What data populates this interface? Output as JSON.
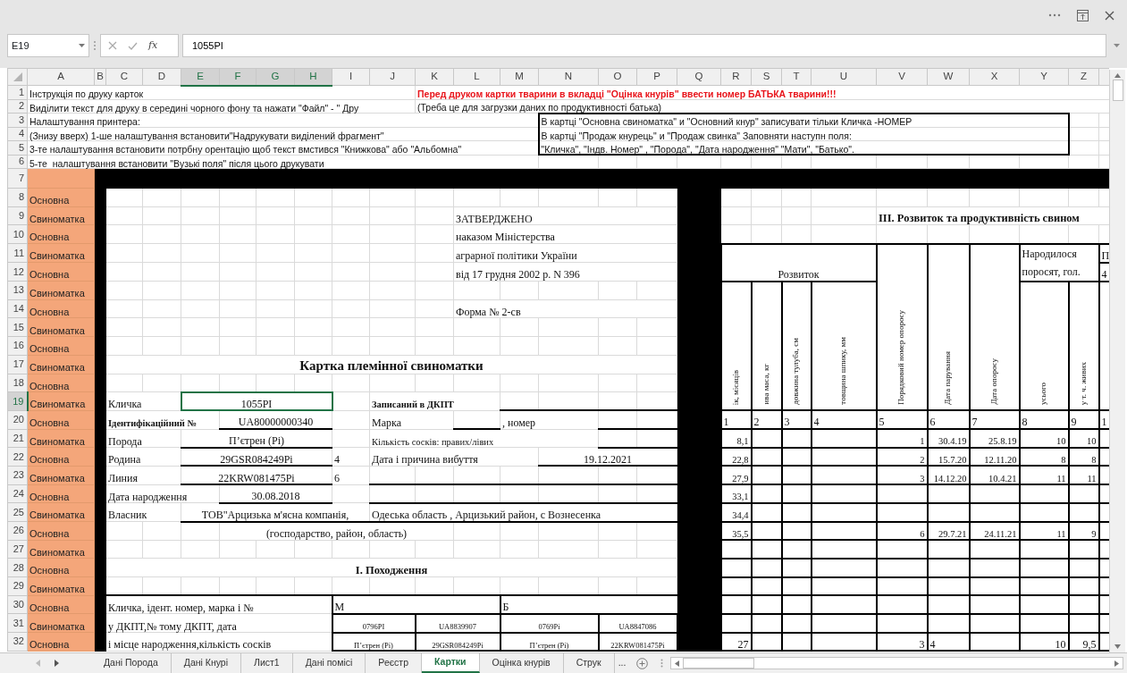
{
  "formula_bar": {
    "name_box": "E19",
    "function_label": "fx",
    "formula": "1055PI"
  },
  "sheet": {
    "columns": [
      {
        "label": "A",
        "selected": false,
        "kind": "category"
      },
      {
        "label": "B",
        "selected": false,
        "kind": "frame"
      },
      {
        "label": "C",
        "selected": false,
        "kind": "plain"
      },
      {
        "label": "D",
        "selected": false,
        "kind": "plain"
      },
      {
        "label": "E",
        "selected": true,
        "kind": "plain"
      },
      {
        "label": "F",
        "selected": true,
        "kind": "plain"
      },
      {
        "label": "G",
        "selected": true,
        "kind": "plain"
      },
      {
        "label": "H",
        "selected": true,
        "kind": "plain"
      },
      {
        "label": "I",
        "selected": false,
        "kind": "plain"
      },
      {
        "label": "J",
        "selected": false,
        "kind": "plain"
      },
      {
        "label": "K",
        "selected": false,
        "kind": "plain"
      },
      {
        "label": "L",
        "selected": false,
        "kind": "plain"
      },
      {
        "label": "M",
        "selected": false,
        "kind": "plain"
      },
      {
        "label": "N",
        "selected": false,
        "kind": "plain"
      },
      {
        "label": "O",
        "selected": false,
        "kind": "plain"
      },
      {
        "label": "P",
        "selected": false,
        "kind": "plain"
      },
      {
        "label": "Q",
        "selected": false,
        "kind": "frame"
      },
      {
        "label": "R",
        "selected": false,
        "kind": "plain"
      },
      {
        "label": "S",
        "selected": false,
        "kind": "plain"
      },
      {
        "label": "T",
        "selected": false,
        "kind": "plain"
      },
      {
        "label": "U",
        "selected": false,
        "kind": "plain"
      },
      {
        "label": "V",
        "selected": false,
        "kind": "plain"
      },
      {
        "label": "W",
        "selected": false,
        "kind": "plain"
      },
      {
        "label": "X",
        "selected": false,
        "kind": "plain"
      },
      {
        "label": "Y",
        "selected": false,
        "kind": "plain"
      },
      {
        "label": "Z",
        "selected": false,
        "kind": "plain"
      },
      {
        "selected": false,
        "kind": "plain"
      }
    ],
    "rows": [
      {
        "label": "1",
        "kind": "note",
        "selected": false,
        "cells": [
          {
            "text": "Інструкція по друку карток",
            "colspan": 10
          },
          {
            "text": "Перед друком картки тварини в вкладці \"Оцінка кнурів\" ввести номер БАТЬКА тварини!!!",
            "kind": "warning",
            "colspan": 17
          }
        ]
      },
      {
        "label": "2",
        "kind": "note",
        "selected": false,
        "cells": [
          {
            "text": "Виділити текст для друку в середині чорного фону та нажати \"Файл\" - \" Дру",
            "colspan": 10
          },
          {
            "text": "(Треба це для загрузки даних по продуктивності батька)",
            "colspan": 17
          }
        ]
      },
      {
        "label": "3",
        "kind": "note",
        "selected": false,
        "cells": [
          {
            "text": "Налаштування принтера:",
            "colspan": 13
          },
          {
            "text": "В картці \"Основна свиноматка\" и \"Основний кнур\" записувати тільки Кличка -НОМЕР",
            "colspan": 12
          },
          {
            "text": "",
            "colspan": 2
          }
        ]
      },
      {
        "label": "4",
        "kind": "note",
        "selected": false,
        "cells": [
          {
            "text": "(Знизу вверх) 1-ше налаштування встановити\"Надрукувати виділений фрагмент\"",
            "colspan": 13
          },
          {
            "text": "В картці \"Продаж кнурець\" и \"Продаж свинка\" Заповняти наступн поля:",
            "colspan": 12
          },
          {
            "text": "",
            "colspan": 2
          }
        ]
      },
      {
        "label": "5",
        "kind": "note",
        "selected": false,
        "cells": [
          {
            "text": "3-те налаштування встановити потрбну орентацію щоб текст вмстився \"Книжкова\" або \"Альбомна\"",
            "colspan": 13
          },
          {
            "text": "\"Кличка\", \"Індв. Номер\" , \"Порода\", \"Дата народження\" \"Мати\", \"Батько\".",
            "colspan": 12
          },
          {
            "text": "",
            "colspan": 2
          }
        ]
      },
      {
        "label": "6",
        "kind": "note",
        "selected": false,
        "cells": [
          {
            "text": "5-те  налаштування встановити \"Вузькі поля\" після цього друкувати",
            "colspan": 13
          },
          {
            "text": "",
            "colspan": 14
          }
        ]
      },
      {
        "label": "7",
        "kind": "gap",
        "selected": false,
        "cells": [
          {
            "text": ""
          },
          {
            "text": "",
            "colspan": 26
          }
        ]
      },
      {
        "label": "8",
        "kind": "form",
        "selected": false,
        "cells": [
          {
            "text": "Основна",
            "kind": "category"
          },
          {
            "text": ""
          },
          {
            "text": "",
            "colspan": 14
          },
          {
            "text": ""
          },
          {
            "text": "",
            "colspan": 10
          }
        ]
      },
      {
        "label": "9",
        "kind": "form",
        "selected": false,
        "cells": [
          {
            "text": "Свиноматка",
            "kind": "category"
          },
          {
            "text": ""
          },
          {
            "text": "",
            "colspan": 9
          },
          {
            "text": "ЗАТВЕРДЖЕНО",
            "colspan": 5
          },
          {
            "text": ""
          },
          {
            "text": "",
            "colspan": 4
          },
          {
            "text": "ІІІ. Розвиток та продуктивність свином",
            "kind": "heading",
            "colspan": 6
          }
        ]
      },
      {
        "label": "10",
        "kind": "form",
        "selected": false,
        "cells": [
          {
            "text": "Основна",
            "kind": "category"
          },
          {
            "text": ""
          },
          {
            "text": "",
            "colspan": 9
          },
          {
            "text": "наказом Міністерства",
            "colspan": 5
          },
          {
            "text": ""
          },
          {
            "text": "",
            "colspan": 10
          }
        ]
      },
      {
        "label": "11",
        "kind": "form",
        "selected": false,
        "cells": [
          {
            "text": "Свиноматка",
            "kind": "category"
          },
          {
            "text": ""
          },
          {
            "text": "",
            "colspan": 9
          },
          {
            "text": "аграрної політики України",
            "colspan": 5
          },
          {
            "text": ""
          },
          {
            "text": "Розвиток",
            "colspan": 4,
            "rowspan": 2
          },
          {
            "text": "",
            "rowspan": 2
          },
          {
            "text": "",
            "rowspan": 2
          },
          {
            "text": "",
            "rowspan": 2
          },
          {
            "text": "Народилося поросят, гол.",
            "kind": "wrapped",
            "colspan": 2,
            "rowspan": 2
          },
          {
            "text": "П"
          }
        ]
      },
      {
        "label": "12",
        "kind": "form",
        "selected": false,
        "cells": [
          {
            "text": "Основна",
            "kind": "category"
          },
          {
            "text": ""
          },
          {
            "text": "",
            "colspan": 9
          },
          {
            "text": "від 17 грудня 2002 р. N 396",
            "colspan": 5
          },
          {
            "text": ""
          },
          {
            "text": "4"
          }
        ]
      },
      {
        "label": "13",
        "kind": "form",
        "selected": false,
        "cells": [
          {
            "text": "Свиноматка",
            "kind": "category"
          },
          {
            "text": ""
          },
          {
            "text": "",
            "colspan": 14
          },
          {
            "text": ""
          },
          {
            "text": "ік, місяців",
            "kind": "vertical",
            "rowspan": 7
          },
          {
            "text": "ива маса, кг",
            "kind": "vertical",
            "rowspan": 7
          },
          {
            "text": "довжина тулуба, см",
            "kind": "vertical",
            "rowspan": 7
          },
          {
            "text": "товщина шпику, мм",
            "kind": "vertical",
            "rowspan": 7
          },
          {
            "text": "Порядковий номер опоросу",
            "kind": "vertical",
            "rowspan": 7
          },
          {
            "text": "Дата парування",
            "kind": "vertical",
            "rowspan": 7
          },
          {
            "text": "Дата опоросу",
            "kind": "vertical",
            "rowspan": 7
          },
          {
            "text": "усього",
            "kind": "vertical",
            "rowspan": 7
          },
          {
            "text": "у т. ч. живих",
            "kind": "vertical",
            "rowspan": 7
          },
          {
            "text": "",
            "rowspan": 7
          }
        ]
      },
      {
        "label": "14",
        "kind": "form",
        "selected": false,
        "cells": [
          {
            "text": "Основна",
            "kind": "category"
          },
          {
            "text": ""
          },
          {
            "text": "",
            "colspan": 9
          },
          {
            "text": "Форма № 2-св",
            "colspan": 5
          },
          {
            "text": ""
          }
        ]
      },
      {
        "label": "15",
        "kind": "form",
        "selected": false,
        "cells": [
          {
            "text": "Свиноматка",
            "kind": "category"
          },
          {
            "text": ""
          },
          {
            "text": "",
            "colspan": 14
          },
          {
            "text": ""
          }
        ]
      },
      {
        "label": "16",
        "kind": "form",
        "selected": false,
        "cells": [
          {
            "text": "Основна",
            "kind": "category"
          },
          {
            "text": ""
          },
          {
            "text": "",
            "colspan": 14
          },
          {
            "text": ""
          }
        ]
      },
      {
        "label": "17",
        "kind": "form",
        "selected": false,
        "cells": [
          {
            "text": "Свиноматка",
            "kind": "category"
          },
          {
            "text": ""
          },
          {
            "text": "Картка племінної свиноматки",
            "kind": "title",
            "colspan": 14
          },
          {
            "text": ""
          }
        ]
      },
      {
        "label": "18",
        "kind": "form",
        "selected": false,
        "cells": [
          {
            "text": "Основна",
            "kind": "category"
          },
          {
            "text": ""
          },
          {
            "text": "",
            "colspan": 14
          },
          {
            "text": ""
          }
        ]
      },
      {
        "label": "19",
        "kind": "form",
        "selected": true,
        "cells": [
          {
            "text": "Свиноматка",
            "kind": "category"
          },
          {
            "text": ""
          },
          {
            "text": "Кличка",
            "colspan": 2
          },
          {
            "text": "1055PI",
            "colspan": 4
          },
          {
            "text": ""
          },
          {
            "text": "Записаний в ДКПТ",
            "kind": "label",
            "colspan": 3
          },
          {
            "text": "",
            "colspan": 4
          },
          {
            "text": ""
          }
        ]
      },
      {
        "label": "20",
        "kind": "form",
        "selected": false,
        "cells": [
          {
            "text": "Основна",
            "kind": "category"
          },
          {
            "text": ""
          },
          {
            "text": "Ідентифікаційний №",
            "kind": "label",
            "colspan": 3
          },
          {
            "text": "UA80000000340",
            "colspan": 3
          },
          {
            "text": ""
          },
          {
            "text": "Марка",
            "colspan": 2
          },
          {
            "text": ""
          },
          {
            "text": ", номер",
            "colspan": 2
          },
          {
            "text": "",
            "colspan": 2
          },
          {
            "text": ""
          },
          {
            "text": "1"
          },
          {
            "text": "2"
          },
          {
            "text": "3"
          },
          {
            "text": "4"
          },
          {
            "text": "5"
          },
          {
            "text": "6"
          },
          {
            "text": "7"
          },
          {
            "text": "8"
          },
          {
            "text": "9"
          },
          {
            "text": "1"
          }
        ]
      },
      {
        "label": "21",
        "kind": "form",
        "selected": false,
        "cells": [
          {
            "text": "Свиноматка",
            "kind": "category"
          },
          {
            "text": ""
          },
          {
            "text": "Порода",
            "colspan": 2
          },
          {
            "text": "П’єтрен (Рі)",
            "colspan": 4
          },
          {
            "text": ""
          },
          {
            "text": "Кількість сосків: правих/лівих",
            "kind": "small",
            "colspan": 5
          },
          {
            "text": "",
            "colspan": 2
          },
          {
            "text": ""
          },
          {
            "text": "8,1",
            "kind": "small"
          },
          {
            "text": ""
          },
          {
            "text": ""
          },
          {
            "text": ""
          },
          {
            "text": "1",
            "kind": "small"
          },
          {
            "text": "30.4.19",
            "kind": "small"
          },
          {
            "text": "25.8.19",
            "kind": "small"
          },
          {
            "text": "10",
            "kind": "small"
          },
          {
            "text": "10",
            "kind": "small"
          },
          {
            "text": ""
          }
        ]
      },
      {
        "label": "22",
        "kind": "form",
        "selected": false,
        "cells": [
          {
            "text": "Основна",
            "kind": "category"
          },
          {
            "text": ""
          },
          {
            "text": "Родина",
            "colspan": 2
          },
          {
            "text": "29GSR084249Pi",
            "colspan": 4
          },
          {
            "text": "4"
          },
          {
            "text": "Дата і причина вибуття",
            "colspan": 4
          },
          {
            "text": "19.12.2021",
            "colspan": 3
          },
          {
            "text": ""
          },
          {
            "text": "22,8",
            "kind": "small"
          },
          {
            "text": ""
          },
          {
            "text": ""
          },
          {
            "text": ""
          },
          {
            "text": "2",
            "kind": "small"
          },
          {
            "text": "15.7.20",
            "kind": "small"
          },
          {
            "text": "12.11.20",
            "kind": "small"
          },
          {
            "text": "8",
            "kind": "small"
          },
          {
            "text": "8",
            "kind": "small"
          },
          {
            "text": ""
          }
        ]
      },
      {
        "label": "23",
        "kind": "form",
        "selected": false,
        "cells": [
          {
            "text": "Свиноматка",
            "kind": "category"
          },
          {
            "text": ""
          },
          {
            "text": "Линия",
            "colspan": 2
          },
          {
            "text": "22KRW081475Pi",
            "colspan": 4
          },
          {
            "text": "6"
          },
          {
            "text": "",
            "colspan": 7
          },
          {
            "text": ""
          },
          {
            "text": "27,9",
            "kind": "small"
          },
          {
            "text": ""
          },
          {
            "text": ""
          },
          {
            "text": ""
          },
          {
            "text": "3",
            "kind": "small"
          },
          {
            "text": "14.12.20",
            "kind": "small"
          },
          {
            "text": "10.4.21",
            "kind": "small"
          },
          {
            "text": "11",
            "kind": "small"
          },
          {
            "text": "11",
            "kind": "small"
          },
          {
            "text": ""
          }
        ]
      },
      {
        "label": "24",
        "kind": "form",
        "selected": false,
        "cells": [
          {
            "text": "Основна",
            "kind": "category"
          },
          {
            "text": ""
          },
          {
            "text": "Дата народження",
            "colspan": 3
          },
          {
            "text": "30.08.2018",
            "colspan": 3
          },
          {
            "text": ""
          },
          {
            "text": "",
            "colspan": 7
          },
          {
            "text": ""
          },
          {
            "text": "33,1",
            "kind": "small"
          },
          {
            "text": "",
            "colspan": 9
          }
        ]
      },
      {
        "label": "25",
        "kind": "form",
        "selected": false,
        "cells": [
          {
            "text": "Свиноматка",
            "kind": "category"
          },
          {
            "text": ""
          },
          {
            "text": "Власник",
            "colspan": 2
          },
          {
            "text": "ТОВ\"Арцизька м'ясна компанія,",
            "colspan": 5
          },
          {
            "text": "Одеська область , Арцизький район, с Вознесенка",
            "colspan": 7
          },
          {
            "text": ""
          },
          {
            "text": "34,4",
            "kind": "small"
          },
          {
            "text": "",
            "colspan": 9
          }
        ]
      },
      {
        "label": "26",
        "kind": "form",
        "selected": false,
        "cells": [
          {
            "text": "Основна",
            "kind": "category"
          },
          {
            "text": ""
          },
          {
            "text": "",
            "colspan": 3
          },
          {
            "text": "(господарство, район, область)",
            "colspan": 6
          },
          {
            "text": "",
            "colspan": 5
          },
          {
            "text": ""
          },
          {
            "text": "35,5",
            "kind": "small"
          },
          {
            "text": ""
          },
          {
            "text": ""
          },
          {
            "text": ""
          },
          {
            "text": "6",
            "kind": "small"
          },
          {
            "text": "29.7.21",
            "kind": "small"
          },
          {
            "text": "24.11.21",
            "kind": "small"
          },
          {
            "text": "11",
            "kind": "small"
          },
          {
            "text": "9",
            "kind": "small"
          },
          {
            "text": ""
          }
        ]
      },
      {
        "label": "27",
        "kind": "form",
        "selected": false,
        "cells": [
          {
            "text": "Свиноматка",
            "kind": "category"
          },
          {
            "text": ""
          },
          {
            "text": "",
            "colspan": 14
          },
          {
            "text": ""
          },
          {
            "text": "",
            "colspan": 10
          }
        ]
      },
      {
        "label": "28",
        "kind": "form",
        "selected": false,
        "cells": [
          {
            "text": "Основна",
            "kind": "category"
          },
          {
            "text": ""
          },
          {
            "text": "І. Походження",
            "kind": "heading",
            "colspan": 14
          },
          {
            "text": ""
          },
          {
            "text": "",
            "colspan": 10
          }
        ]
      },
      {
        "label": "29",
        "kind": "form",
        "selected": false,
        "cells": [
          {
            "text": "Свиноматка",
            "kind": "category"
          },
          {
            "text": ""
          },
          {
            "text": "",
            "colspan": 14
          },
          {
            "text": ""
          },
          {
            "text": "",
            "colspan": 10
          }
        ]
      },
      {
        "label": "30",
        "kind": "form",
        "selected": false,
        "cells": [
          {
            "text": "Основна",
            "kind": "category"
          },
          {
            "text": ""
          },
          {
            "text": "Кличка, ідент. номер, марка і №",
            "colspan": 6
          },
          {
            "text": "М",
            "colspan": 4
          },
          {
            "text": "Б",
            "colspan": 4
          },
          {
            "text": ""
          },
          {
            "text": "",
            "colspan": 10
          }
        ]
      },
      {
        "label": "31",
        "kind": "form",
        "selected": false,
        "cells": [
          {
            "text": "Свиноматка",
            "kind": "category"
          },
          {
            "text": ""
          },
          {
            "text": "у ДКПТ,№ тому ДКПТ, дата",
            "colspan": 6
          },
          {
            "text": "0796PI",
            "kind": "tiny",
            "colspan": 2
          },
          {
            "text": "UA8839907",
            "kind": "tiny",
            "colspan": 2
          },
          {
            "text": "0769Pi",
            "kind": "tiny",
            "colspan": 2
          },
          {
            "text": "UA8847086",
            "kind": "tiny",
            "colspan": 2
          },
          {
            "text": ""
          },
          {
            "text": "",
            "colspan": 10
          }
        ]
      },
      {
        "label": "32",
        "kind": "form",
        "selected": false,
        "cells": [
          {
            "text": "Основна",
            "kind": "category"
          },
          {
            "text": ""
          },
          {
            "text": "і місце народження,кількість сосків",
            "colspan": 6
          },
          {
            "text": "П’єтрен (Рі)",
            "kind": "tiny",
            "colspan": 2
          },
          {
            "text": "29GSR084249Pi",
            "kind": "tiny",
            "colspan": 2
          },
          {
            "text": "П’єтрен (Рі)",
            "kind": "tiny",
            "colspan": 2
          },
          {
            "text": "22KRW081475Pi",
            "kind": "tiny",
            "colspan": 2
          },
          {
            "text": ""
          },
          {
            "text": "27"
          },
          {
            "text": ""
          },
          {
            "text": ""
          },
          {
            "text": ""
          },
          {
            "text": "3"
          },
          {
            "text": "4"
          },
          {
            "text": ""
          },
          {
            "text": "10"
          },
          {
            "text": "9,5"
          },
          {
            "text": ""
          }
        ]
      }
    ]
  },
  "sheet_tabs": [
    {
      "label": "Дані Порода",
      "selected": false
    },
    {
      "label": "Дані Кнурі",
      "selected": false
    },
    {
      "label": "Лист1",
      "selected": false
    },
    {
      "label": "Дані помісі",
      "selected": false
    },
    {
      "label": "Реєстр",
      "selected": false
    },
    {
      "label": "Картки",
      "selected": true
    },
    {
      "label": "Оцінка кнурів",
      "selected": false
    },
    {
      "label": "Струк",
      "selected": false
    }
  ],
  "tab_overflow": "..."
}
